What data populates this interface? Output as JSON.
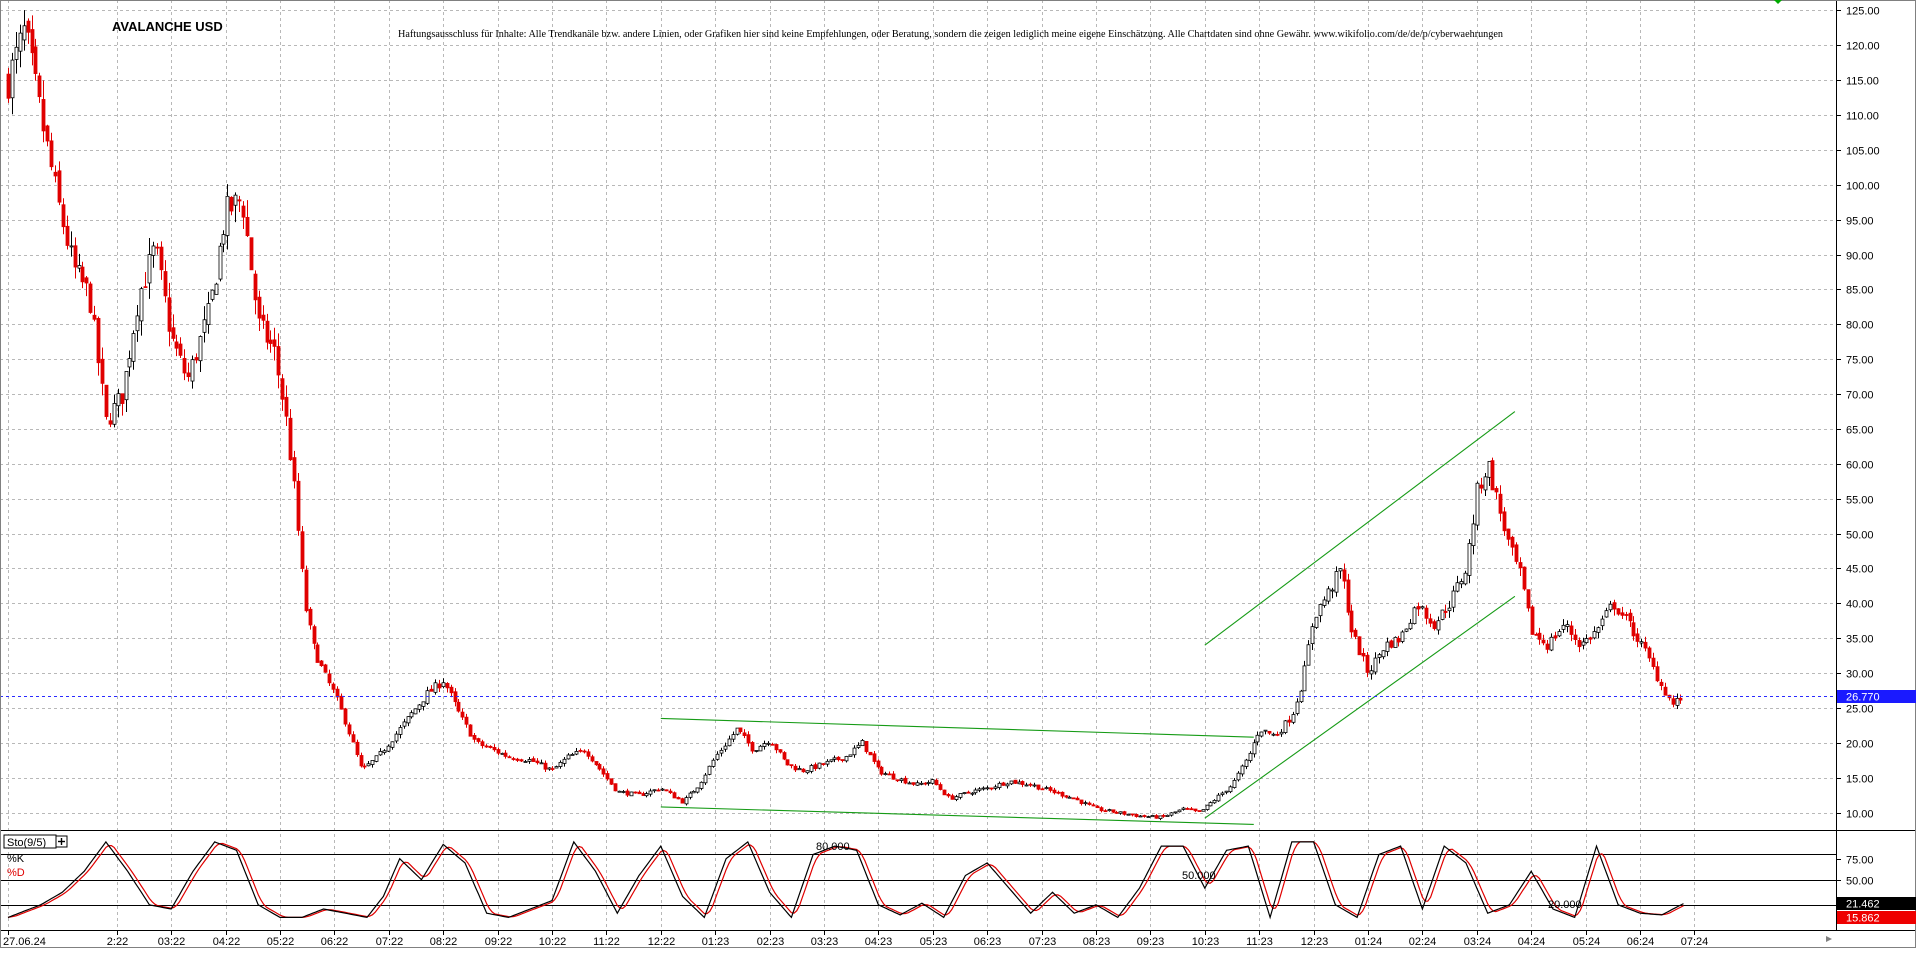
{
  "chart_data": [
    {
      "type": "candlestick",
      "title": "AVALANCHE USD",
      "disclaimer": "Haftungsausschluss für Inhalte: Alle Trendkanäle bzw. andere Linien, oder Grafiken hier sind keine Empfehlungen, oder Beratung, sondern die zeigen lediglich meine eigene Einschätzung. Alle Chartdaten sind ohne Gewähr.  www.wikifolio.com/de/de/p/cyberwaehrungen",
      "y_ticks": [
        "125.00",
        "120.00",
        "115.00",
        "110.00",
        "105.00",
        "100.00",
        "95.00",
        "90.00",
        "85.00",
        "80.00",
        "75.00",
        "70.00",
        "65.00",
        "60.00",
        "55.00",
        "50.00",
        "45.00",
        "40.00",
        "35.00",
        "30.00",
        "25.00",
        "20.00",
        "15.00",
        "10.00"
      ],
      "y_tick_values": [
        125,
        120,
        115,
        110,
        105,
        100,
        95,
        90,
        85,
        80,
        75,
        70,
        65,
        60,
        55,
        50,
        45,
        40,
        35,
        30,
        25,
        20,
        15,
        10
      ],
      "ylim": [
        7.5,
        126.5
      ],
      "x_labels": [
        "27.06.24",
        "2:22",
        "03:22",
        "04:22",
        "05:22",
        "06:22",
        "07:22",
        "08:22",
        "09:22",
        "10:22",
        "11:22",
        "12:22",
        "01:23",
        "02:23",
        "03:23",
        "04:23",
        "05:23",
        "06:23",
        "07:23",
        "08:23",
        "09:23",
        "10:23",
        "11:23",
        "12:23",
        "01:24",
        "02:24",
        "03:24",
        "04:24",
        "05:24",
        "06:24",
        "07:24"
      ],
      "x_label_months": [
        0,
        2,
        3,
        4,
        5,
        6,
        7,
        8,
        9,
        10,
        11,
        12,
        13,
        14,
        15,
        16,
        17,
        18,
        19,
        20,
        21,
        22,
        23,
        24,
        25,
        26,
        27,
        28,
        29,
        30,
        31
      ],
      "xlim_months": [
        0,
        32.5
      ],
      "last_price": 26.77,
      "last_price_label": "26.770",
      "price_anchors": [
        {
          "m": 0.0,
          "p": 115
        },
        {
          "m": 0.3,
          "p": 122
        },
        {
          "m": 0.6,
          "p": 110
        },
        {
          "m": 0.9,
          "p": 98
        },
        {
          "m": 1.2,
          "p": 88
        },
        {
          "m": 1.5,
          "p": 84
        },
        {
          "m": 1.8,
          "p": 66
        },
        {
          "m": 2.1,
          "p": 70
        },
        {
          "m": 2.4,
          "p": 84
        },
        {
          "m": 2.7,
          "p": 91
        },
        {
          "m": 3.0,
          "p": 78
        },
        {
          "m": 3.3,
          "p": 72
        },
        {
          "m": 3.7,
          "p": 82
        },
        {
          "m": 4.0,
          "p": 96
        },
        {
          "m": 4.3,
          "p": 98
        },
        {
          "m": 4.6,
          "p": 80
        },
        {
          "m": 4.9,
          "p": 76
        },
        {
          "m": 5.1,
          "p": 67
        },
        {
          "m": 5.25,
          "p": 57
        },
        {
          "m": 5.45,
          "p": 40
        },
        {
          "m": 5.6,
          "p": 34
        },
        {
          "m": 5.8,
          "p": 30
        },
        {
          "m": 6.0,
          "p": 27
        },
        {
          "m": 6.2,
          "p": 23
        },
        {
          "m": 6.5,
          "p": 16
        },
        {
          "m": 6.8,
          "p": 18
        },
        {
          "m": 7.1,
          "p": 21
        },
        {
          "m": 7.4,
          "p": 24
        },
        {
          "m": 7.7,
          "p": 27
        },
        {
          "m": 8.0,
          "p": 29
        },
        {
          "m": 8.3,
          "p": 24
        },
        {
          "m": 8.6,
          "p": 20
        },
        {
          "m": 8.9,
          "p": 19
        },
        {
          "m": 9.2,
          "p": 18
        },
        {
          "m": 9.6,
          "p": 17.5
        },
        {
          "m": 10.0,
          "p": 16
        },
        {
          "m": 10.3,
          "p": 18
        },
        {
          "m": 10.6,
          "p": 19
        },
        {
          "m": 10.9,
          "p": 16
        },
        {
          "m": 11.2,
          "p": 13
        },
        {
          "m": 11.6,
          "p": 12.5
        },
        {
          "m": 12.0,
          "p": 13.5
        },
        {
          "m": 12.4,
          "p": 11.5
        },
        {
          "m": 12.7,
          "p": 14
        },
        {
          "m": 13.0,
          "p": 18
        },
        {
          "m": 13.4,
          "p": 22
        },
        {
          "m": 13.7,
          "p": 19
        },
        {
          "m": 14.0,
          "p": 20.5
        },
        {
          "m": 14.3,
          "p": 17
        },
        {
          "m": 14.6,
          "p": 16
        },
        {
          "m": 15.0,
          "p": 17
        },
        {
          "m": 15.4,
          "p": 18
        },
        {
          "m": 15.7,
          "p": 20
        },
        {
          "m": 16.0,
          "p": 16
        },
        {
          "m": 16.3,
          "p": 15
        },
        {
          "m": 16.7,
          "p": 14
        },
        {
          "m": 17.0,
          "p": 14.5
        },
        {
          "m": 17.3,
          "p": 12
        },
        {
          "m": 17.7,
          "p": 13
        },
        {
          "m": 18.0,
          "p": 13.5
        },
        {
          "m": 18.4,
          "p": 14.5
        },
        {
          "m": 18.8,
          "p": 14
        },
        {
          "m": 19.2,
          "p": 13
        },
        {
          "m": 19.6,
          "p": 12
        },
        {
          "m": 20.0,
          "p": 10.5
        },
        {
          "m": 20.4,
          "p": 10
        },
        {
          "m": 20.8,
          "p": 9.5
        },
        {
          "m": 21.2,
          "p": 9.3
        },
        {
          "m": 21.6,
          "p": 10.5
        },
        {
          "m": 21.9,
          "p": 10
        },
        {
          "m": 22.2,
          "p": 12
        },
        {
          "m": 22.5,
          "p": 14
        },
        {
          "m": 22.8,
          "p": 18
        },
        {
          "m": 23.0,
          "p": 22
        },
        {
          "m": 23.3,
          "p": 21
        },
        {
          "m": 23.6,
          "p": 24
        },
        {
          "m": 23.8,
          "p": 29
        },
        {
          "m": 24.0,
          "p": 38
        },
        {
          "m": 24.3,
          "p": 42
        },
        {
          "m": 24.5,
          "p": 45
        },
        {
          "m": 24.7,
          "p": 36
        },
        {
          "m": 25.0,
          "p": 30
        },
        {
          "m": 25.3,
          "p": 34
        },
        {
          "m": 25.6,
          "p": 35
        },
        {
          "m": 25.9,
          "p": 40
        },
        {
          "m": 26.2,
          "p": 37
        },
        {
          "m": 26.5,
          "p": 40
        },
        {
          "m": 26.8,
          "p": 45
        },
        {
          "m": 27.0,
          "p": 56
        },
        {
          "m": 27.2,
          "p": 60
        },
        {
          "m": 27.4,
          "p": 54
        },
        {
          "m": 27.6,
          "p": 48
        },
        {
          "m": 27.8,
          "p": 44
        },
        {
          "m": 28.0,
          "p": 36
        },
        {
          "m": 28.3,
          "p": 34
        },
        {
          "m": 28.6,
          "p": 37
        },
        {
          "m": 28.9,
          "p": 34
        },
        {
          "m": 29.2,
          "p": 36
        },
        {
          "m": 29.5,
          "p": 40
        },
        {
          "m": 29.8,
          "p": 37
        },
        {
          "m": 30.1,
          "p": 33
        },
        {
          "m": 30.4,
          "p": 28
        },
        {
          "m": 30.6,
          "p": 25.5
        },
        {
          "m": 30.8,
          "p": 26.77
        }
      ],
      "trend_lines": [
        {
          "m1": 12.0,
          "p1": 23.5,
          "m2": 22.9,
          "p2": 20.8
        },
        {
          "m1": 12.0,
          "p1": 10.8,
          "m2": 22.9,
          "p2": 8.3
        },
        {
          "m1": 22.0,
          "p1": 9.2,
          "m2": 27.7,
          "p2": 41.0
        },
        {
          "m1": 22.0,
          "p1": 34.0,
          "m2": 27.7,
          "p2": 67.5
        }
      ]
    },
    {
      "type": "line",
      "indicator": "Sto(9/5)",
      "series_names": [
        "%K",
        "%D"
      ],
      "colors": {
        "k": "#000000",
        "d": "#e00000"
      },
      "levels": [
        80,
        50,
        20
      ],
      "level_labels": [
        "80.000",
        "50.000",
        "20.000"
      ],
      "y_ticks": [
        "75.00",
        "50.00",
        "25.00"
      ],
      "y_tick_values": [
        75,
        50,
        25
      ],
      "ylim": [
        -10,
        108
      ],
      "k_last_label": "21.462",
      "d_last_label": "15.862",
      "k_anchors": [
        {
          "m": 0.0,
          "v": 5
        },
        {
          "m": 0.6,
          "v": 20
        },
        {
          "m": 1.0,
          "v": 35
        },
        {
          "m": 1.4,
          "v": 60
        },
        {
          "m": 1.8,
          "v": 95
        },
        {
          "m": 2.2,
          "v": 60
        },
        {
          "m": 2.6,
          "v": 20
        },
        {
          "m": 3.0,
          "v": 15
        },
        {
          "m": 3.4,
          "v": 60
        },
        {
          "m": 3.8,
          "v": 95
        },
        {
          "m": 4.2,
          "v": 85
        },
        {
          "m": 4.6,
          "v": 20
        },
        {
          "m": 5.0,
          "v": 5
        },
        {
          "m": 5.4,
          "v": 5
        },
        {
          "m": 5.8,
          "v": 15
        },
        {
          "m": 6.2,
          "v": 10
        },
        {
          "m": 6.6,
          "v": 5
        },
        {
          "m": 6.9,
          "v": 30
        },
        {
          "m": 7.2,
          "v": 75
        },
        {
          "m": 7.6,
          "v": 50
        },
        {
          "m": 8.0,
          "v": 92
        },
        {
          "m": 8.4,
          "v": 70
        },
        {
          "m": 8.8,
          "v": 10
        },
        {
          "m": 9.2,
          "v": 5
        },
        {
          "m": 9.6,
          "v": 15
        },
        {
          "m": 10.0,
          "v": 25
        },
        {
          "m": 10.4,
          "v": 95
        },
        {
          "m": 10.8,
          "v": 60
        },
        {
          "m": 11.2,
          "v": 10
        },
        {
          "m": 11.6,
          "v": 55
        },
        {
          "m": 12.0,
          "v": 90
        },
        {
          "m": 12.4,
          "v": 30
        },
        {
          "m": 12.8,
          "v": 5
        },
        {
          "m": 13.2,
          "v": 75
        },
        {
          "m": 13.6,
          "v": 95
        },
        {
          "m": 14.0,
          "v": 35
        },
        {
          "m": 14.4,
          "v": 5
        },
        {
          "m": 14.8,
          "v": 80
        },
        {
          "m": 15.2,
          "v": 90
        },
        {
          "m": 15.6,
          "v": 85
        },
        {
          "m": 16.0,
          "v": 20
        },
        {
          "m": 16.4,
          "v": 8
        },
        {
          "m": 16.8,
          "v": 22
        },
        {
          "m": 17.2,
          "v": 5
        },
        {
          "m": 17.6,
          "v": 55
        },
        {
          "m": 18.0,
          "v": 70
        },
        {
          "m": 18.4,
          "v": 40
        },
        {
          "m": 18.8,
          "v": 10
        },
        {
          "m": 19.2,
          "v": 35
        },
        {
          "m": 19.6,
          "v": 10
        },
        {
          "m": 20.0,
          "v": 20
        },
        {
          "m": 20.4,
          "v": 5
        },
        {
          "m": 20.8,
          "v": 40
        },
        {
          "m": 21.2,
          "v": 90
        },
        {
          "m": 21.6,
          "v": 90
        },
        {
          "m": 22.0,
          "v": 40
        },
        {
          "m": 22.4,
          "v": 85
        },
        {
          "m": 22.8,
          "v": 90
        },
        {
          "m": 23.2,
          "v": 5
        },
        {
          "m": 23.6,
          "v": 95
        },
        {
          "m": 24.0,
          "v": 95
        },
        {
          "m": 24.4,
          "v": 20
        },
        {
          "m": 24.8,
          "v": 5
        },
        {
          "m": 25.2,
          "v": 80
        },
        {
          "m": 25.6,
          "v": 90
        },
        {
          "m": 26.0,
          "v": 15
        },
        {
          "m": 26.4,
          "v": 90
        },
        {
          "m": 26.8,
          "v": 70
        },
        {
          "m": 27.2,
          "v": 10
        },
        {
          "m": 27.6,
          "v": 20
        },
        {
          "m": 28.0,
          "v": 60
        },
        {
          "m": 28.4,
          "v": 15
        },
        {
          "m": 28.8,
          "v": 5
        },
        {
          "m": 29.2,
          "v": 90
        },
        {
          "m": 29.6,
          "v": 20
        },
        {
          "m": 30.0,
          "v": 10
        },
        {
          "m": 30.4,
          "v": 8
        },
        {
          "m": 30.8,
          "v": 21.5
        }
      ]
    }
  ]
}
